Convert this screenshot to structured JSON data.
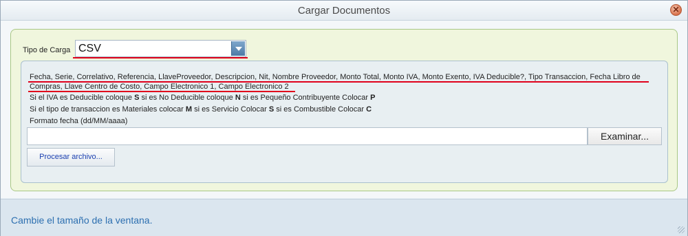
{
  "window": {
    "title": "Cargar Documentos"
  },
  "form": {
    "tipo_label": "Tipo de Carga",
    "tipo_value": "CSV",
    "fields_line": "Fecha, Serie, Correlativo, Referencia, LlaveProveedor, Descripcion, Nit, Nombre Proveedor, Monto Total, Monto IVA, Monto Exento, IVA Deducible?, Tipo Transaccion, Fecha Libro de Compras, Llave Centro de Costo, Campo Electronico 1, Campo Electronico 2",
    "iva_text": {
      "p1": "Si el IVA es Deducible coloque ",
      "b1": "S",
      "p2": " si es No Deducible coloque ",
      "b2": "N",
      "p3": " si es Pequeño Contribuyente Colocar ",
      "b3": "P"
    },
    "tipo_text": {
      "p1": "Si el tipo de transaccion es Materiales colocar ",
      "b1": "M",
      "p2": " si es Servicio Colocar ",
      "b2": "S",
      "p3": " si es Combustible Colocar ",
      "b3": "C"
    },
    "fecha_format": "Formato fecha (dd/MM/aaaa)",
    "file_value": "",
    "browse_label": "Examinar...",
    "process_label": "Procesar archivo..."
  },
  "footer": {
    "status": "Cambie el tamaño de la ventana."
  },
  "colors": {
    "highlight": "#e0001b",
    "link": "#1a3fb0",
    "footer_text": "#2c6fb0"
  }
}
